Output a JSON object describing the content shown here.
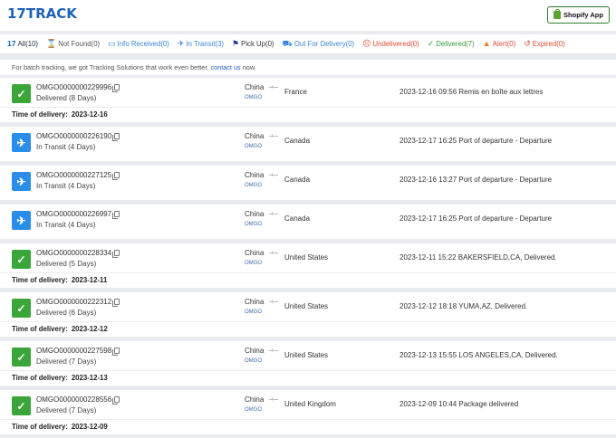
{
  "brand": {
    "logo_num": "17",
    "logo_text": "TRACK"
  },
  "header": {
    "shopify_label": "Shopify App"
  },
  "tabs": [
    {
      "key": "all",
      "icon": "17",
      "label": "All(10)"
    },
    {
      "key": "notfound",
      "icon": "⌛",
      "label": "Not Found(0)"
    },
    {
      "key": "info",
      "icon": "▭",
      "label": "Info Received(0)"
    },
    {
      "key": "transit",
      "icon": "✈",
      "label": "In Transit(3)"
    },
    {
      "key": "pickup",
      "icon": "⚑",
      "label": "Pick Up(0)"
    },
    {
      "key": "out",
      "icon": "⛟",
      "label": "Out For Delivery(0)"
    },
    {
      "key": "undelivered",
      "icon": "☹",
      "label": "Undelivered(0)"
    },
    {
      "key": "delivered",
      "icon": "✓",
      "label": "Delivered(7)"
    },
    {
      "key": "alert",
      "icon": "▲",
      "label": "Alert(0)"
    },
    {
      "key": "expired",
      "icon": "↺",
      "label": "Expired(0)"
    }
  ],
  "notice": {
    "text": "For batch tracking, we got Tracking Solutions that work even better,",
    "link": "contact us",
    "suffix": " now."
  },
  "tod_label": "Time of delivery:",
  "shipments": [
    {
      "status_icon": "check-icon",
      "tracking": "OMGO0000000229996",
      "status": "Delivered (8 Days)",
      "origin": "China",
      "carrier": "OMGO",
      "dest": "France",
      "event": "2023-12-16 09:56  Remis en boîte aux lettres",
      "delivery_time": "2023-12-16"
    },
    {
      "status_icon": "plane-icon",
      "tracking": "OMGO0000000226190",
      "status": "In Transit (4 Days)",
      "origin": "China",
      "carrier": "OMGO",
      "dest": "Canada",
      "event": "2023-12-17 16:25  Port of departure - Departure"
    },
    {
      "status_icon": "plane-icon",
      "tracking": "OMGO0000000227125",
      "status": "In Transit (4 Days)",
      "origin": "China",
      "carrier": "OMGO",
      "dest": "Canada",
      "event": "2023-12-16 13:27  Port of departure - Departure"
    },
    {
      "status_icon": "plane-icon",
      "tracking": "OMGO0000000226997",
      "status": "In Transit (4 Days)",
      "origin": "China",
      "carrier": "OMGO",
      "dest": "Canada",
      "event": "2023-12-17 16:25  Port of departure - Departure"
    },
    {
      "status_icon": "check-icon",
      "tracking": "OMGO0000000228334",
      "status": "Delivered (5 Days)",
      "origin": "China",
      "carrier": "OMGO",
      "dest": "United States",
      "event": "2023-12-11 15:22  BAKERSFIELD,CA, Delivered.",
      "delivery_time": "2023-12-11"
    },
    {
      "status_icon": "check-icon",
      "tracking": "OMGO0000000222312",
      "status": "Delivered (6 Days)",
      "origin": "China",
      "carrier": "OMGO",
      "dest": "United States",
      "event": "2023-12-12 18:18  YUMA,AZ, Delivered.",
      "delivery_time": "2023-12-12"
    },
    {
      "status_icon": "check-icon",
      "tracking": "OMGO0000000227598",
      "status": "Delivered (7 Days)",
      "origin": "China",
      "carrier": "OMGO",
      "dest": "United States",
      "event": "2023-12-13 15:55  LOS ANGELES,CA, Delivered.",
      "delivery_time": "2023-12-13"
    },
    {
      "status_icon": "check-icon",
      "tracking": "OMGO0000000228556",
      "status": "Delivered (7 Days)",
      "origin": "China",
      "carrier": "OMGO",
      "dest": "United Kingdom",
      "event": "2023-12-09 10:44  Package delivered",
      "delivery_time": "2023-12-09"
    }
  ]
}
